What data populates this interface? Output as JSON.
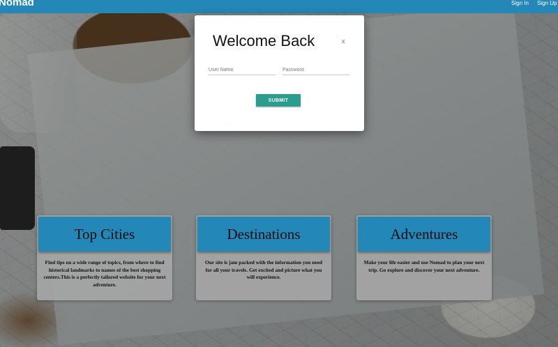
{
  "navbar": {
    "brand": "Nomad",
    "links": [
      "Sign In",
      "Sign Up"
    ]
  },
  "modal": {
    "title": "Welcome Back",
    "close_label": "x",
    "username_placeholder": "User Name",
    "password_placeholder": "Password",
    "username_value": "",
    "password_value": "",
    "submit_label": "SUBMIT"
  },
  "cards": [
    {
      "title": "Top Cities",
      "text": "Find tips on a wide range of topics, from where to find historical landmarks to names of the best shopping centers.This is a perfectly tailored website for your next adventure."
    },
    {
      "title": "Destinations",
      "text": "Our site is jam packed with the information you need for all your travels. Get excited and picture what you will experience."
    },
    {
      "title": "Adventures",
      "text": "Make your life easier and use Nomad to plan your next trip. Go explore and discover your next adventure."
    }
  ],
  "colors": {
    "navbar": "#2387b8",
    "card_header": "#2387b8",
    "submit_button": "#2a9d8f",
    "close_link": "#2f7fd6"
  }
}
